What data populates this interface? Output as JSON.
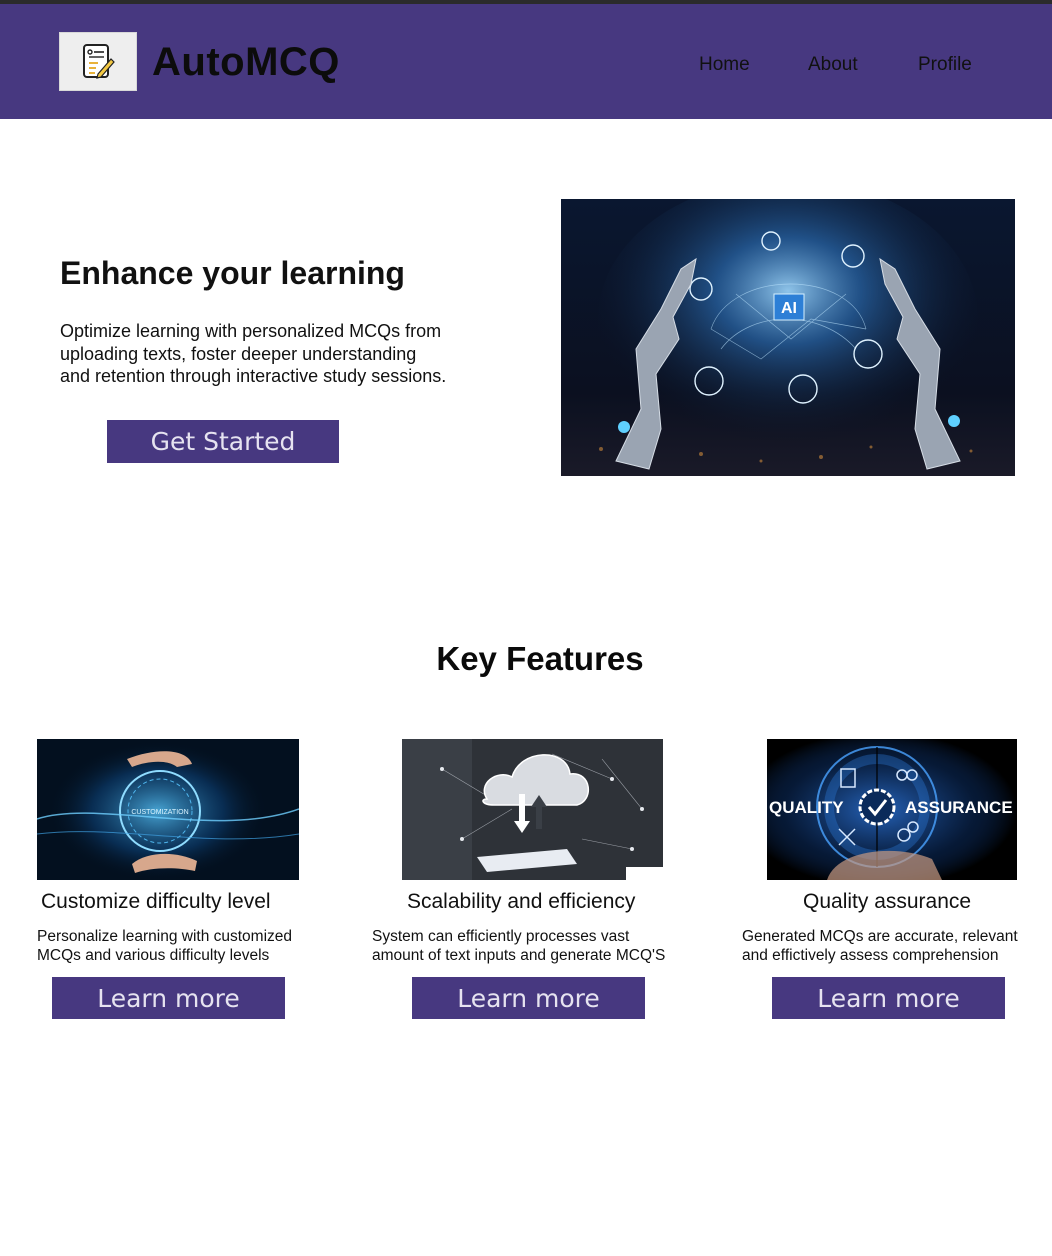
{
  "header": {
    "brand": "AutoMCQ",
    "logo_icon": "mcq-document-pencil-icon",
    "nav": [
      {
        "label": "Home"
      },
      {
        "label": "About"
      },
      {
        "label": "Profile"
      }
    ],
    "background_color": "#473880"
  },
  "hero": {
    "title": "Enhance your learning",
    "text": "Optimize learning with personalized MCQs from\n uploading texts, foster deeper understanding\nand retention through interactive study sessions.",
    "cta_label": "Get Started",
    "image_badge": "AI"
  },
  "features": {
    "title": "Key Features",
    "items": [
      {
        "title": "Customize difficulty level",
        "text": "Personalize learning with customized\nMCQs and various difficulty levels",
        "button_label": "Learn more",
        "image_label": "CUSTOMIZATION"
      },
      {
        "title": "Scalability and efficiency",
        "text": "System can  efficiently processes vast\namount of text inputs and generate MCQ'S",
        "button_label": "Learn more"
      },
      {
        "title": "Quality assurance",
        "text": "Generated MCQs are accurate, relevant\n and effictively assess comprehension",
        "button_label": "Learn more",
        "image_label_left": "QUALITY",
        "image_label_right": "ASSURANCE"
      }
    ]
  },
  "colors": {
    "accent": "#473880",
    "button_text": "#e6e3f0"
  }
}
